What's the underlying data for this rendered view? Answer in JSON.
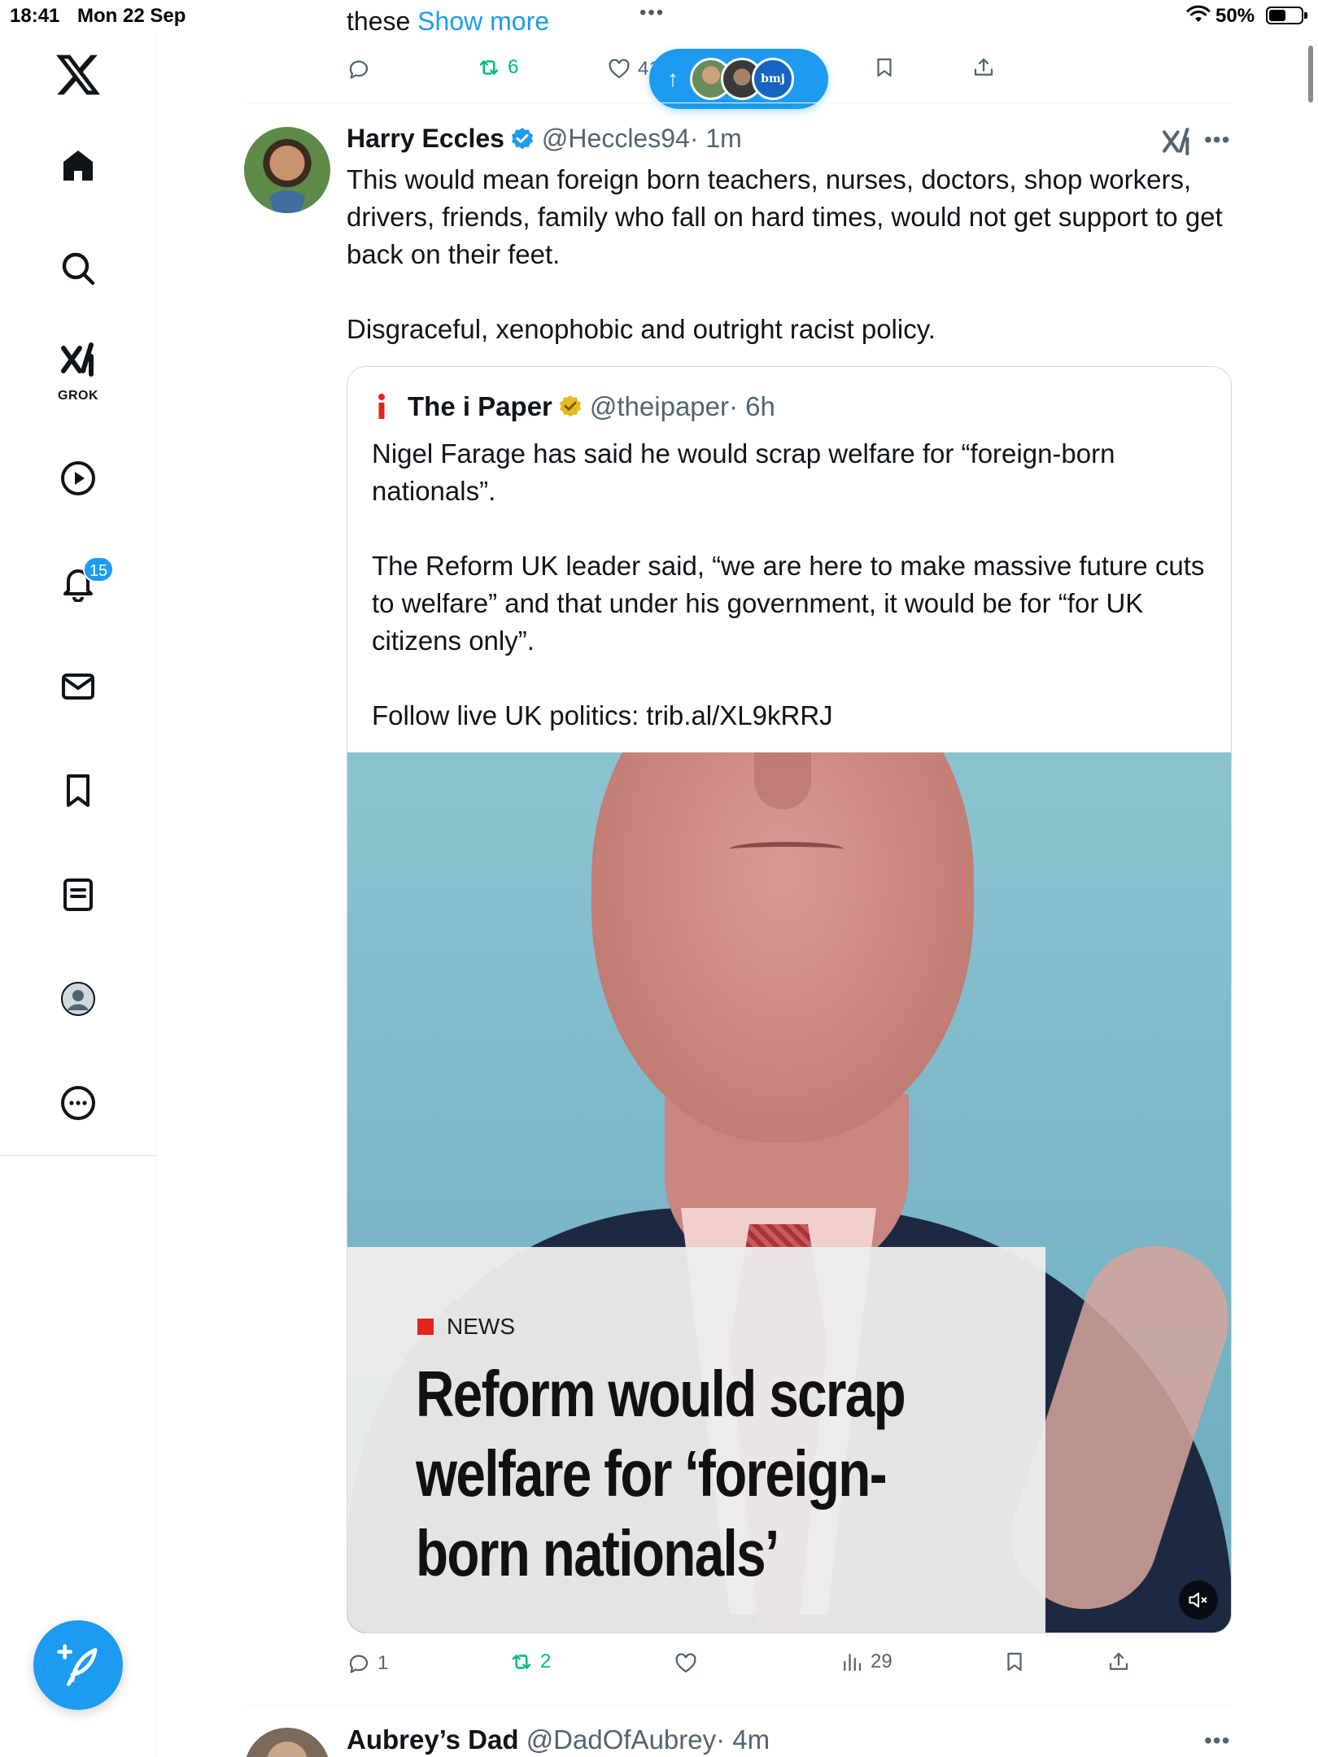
{
  "status_bar": {
    "time": "18:41",
    "date": "Mon 22 Sep",
    "battery_percent": "50%",
    "battery_level": 0.5
  },
  "sidebar": {
    "items": [
      {
        "name": "home",
        "icon": "home-icon"
      },
      {
        "name": "search",
        "icon": "search-icon"
      },
      {
        "name": "grok",
        "icon": "grok-icon",
        "label": "GROK"
      },
      {
        "name": "video",
        "icon": "play-icon"
      },
      {
        "name": "notifications",
        "icon": "bell-icon",
        "badge": "15"
      },
      {
        "name": "messages",
        "icon": "mail-icon"
      },
      {
        "name": "bookmarks",
        "icon": "bookmark-icon"
      },
      {
        "name": "lists",
        "icon": "list-icon"
      },
      {
        "name": "profile",
        "icon": "profile-icon"
      },
      {
        "name": "more",
        "icon": "more-circle-icon"
      }
    ],
    "compose_icon": "compose-feather-icon"
  },
  "previous_tweet": {
    "text_start": "these ",
    "show_more": "Show more",
    "retweets": "6",
    "likes": "41"
  },
  "new_posts_pill": {
    "arrow": "↑",
    "avatar_3_text": "bmj"
  },
  "tweet": {
    "name": "Harry Eccles",
    "handle": "@Heccles94",
    "time": "· 1m",
    "body": "This would mean foreign born teachers, nurses, doctors, shop workers, drivers, friends, family who fall on hard times, would not get support to get back on their feet.\n\nDisgraceful, xenophobic and outright racist policy.",
    "quote": {
      "name": "The i Paper",
      "handle": "@theipaper",
      "time": "· 6h",
      "body": "Nigel Farage has said he would scrap welfare for “foreign-born nationals”.\n\nThe Reform UK leader said, “we are here to make massive future cuts to welfare” and that under his government, it would be for “for UK citizens only”.\n\nFollow live UK politics: trib.al/XL9kRRJ",
      "media": {
        "tag": "NEWS",
        "headline": "Reform would scrap\nwelfare for ‘foreign-\nborn nationals’"
      }
    },
    "replies": "1",
    "retweets": "2",
    "views": "29"
  },
  "next_tweet": {
    "name": "Aubrey’s Dad",
    "handle": "@DadOfAubrey",
    "time": "· 4m"
  },
  "colors": {
    "accent": "#1d9bf0",
    "retweet_green": "#00ba7c",
    "secondary_text": "#536471",
    "news_red": "#e3241b",
    "gold_badge": "#e8b923"
  }
}
